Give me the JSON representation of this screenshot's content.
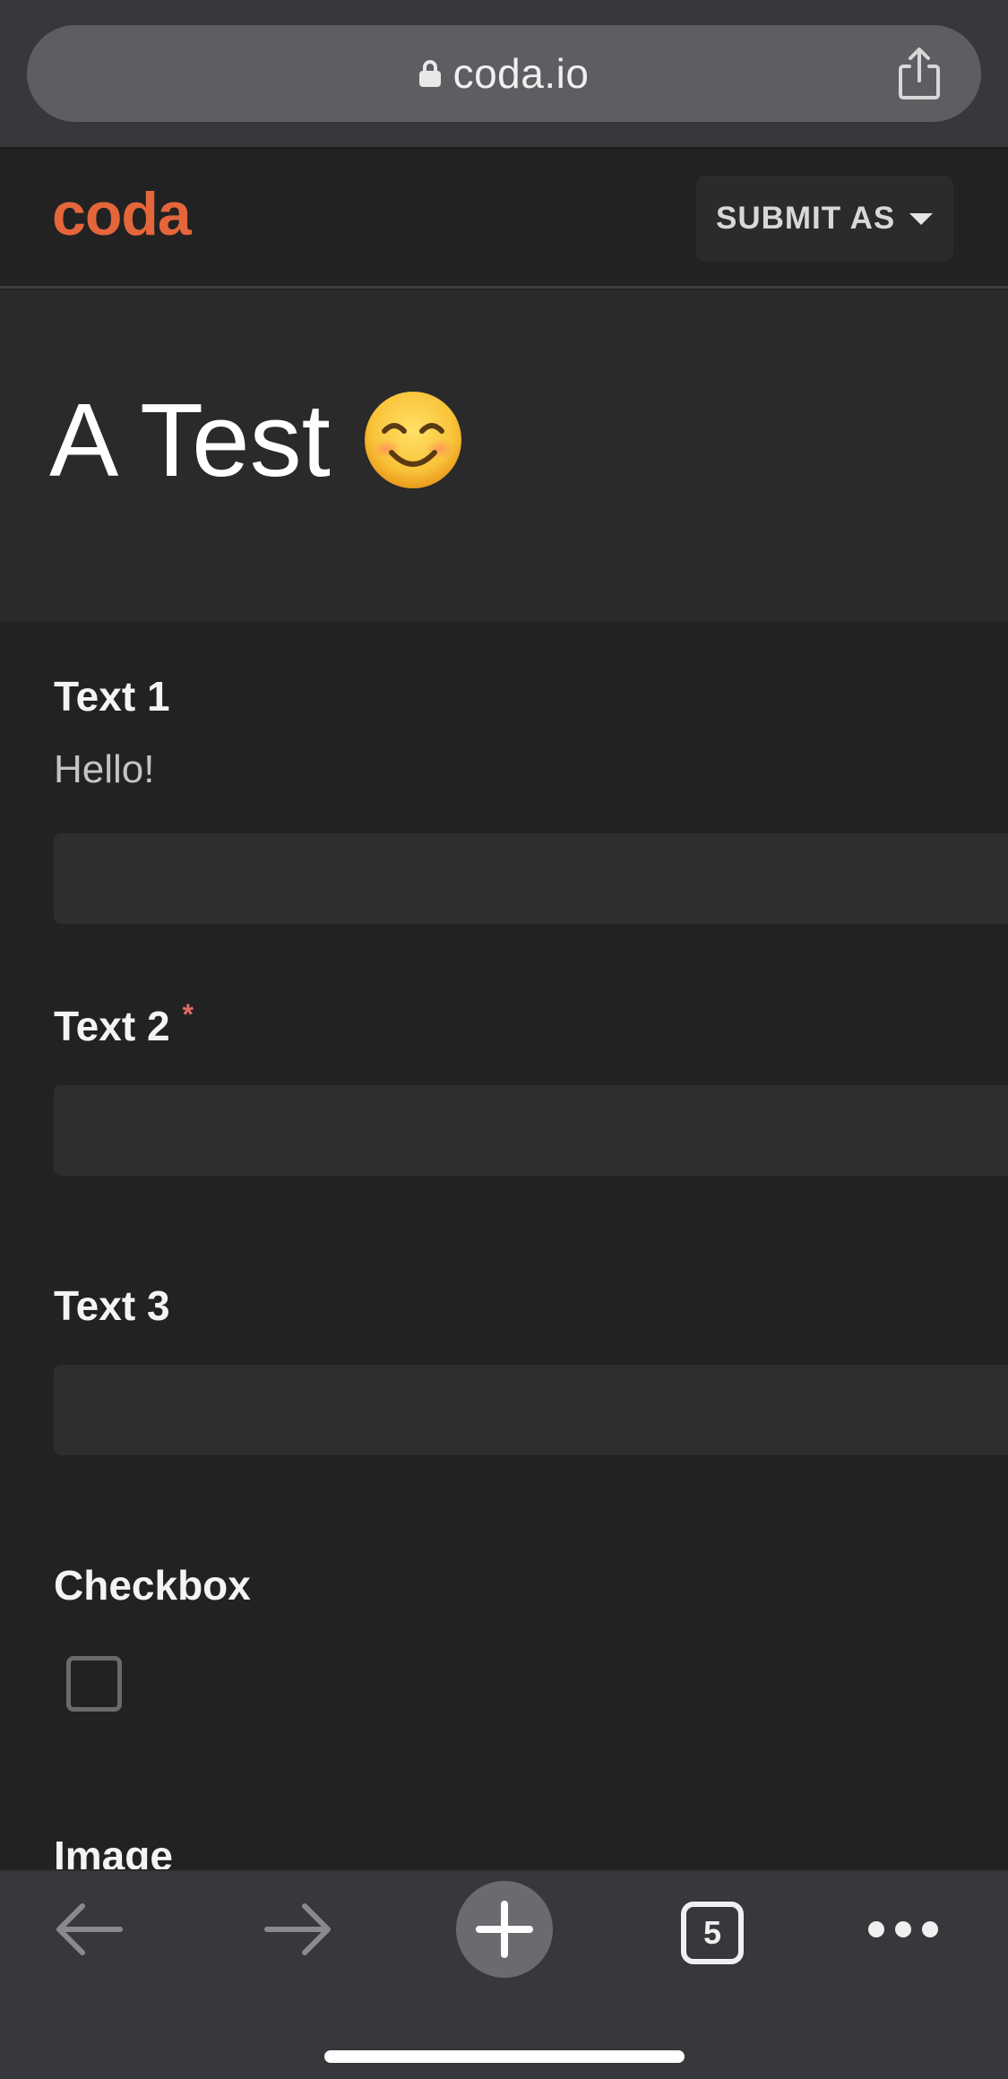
{
  "browser": {
    "url": "coda.io",
    "tabs_count": "5"
  },
  "header": {
    "logo": "coda",
    "submit_as_label": "SUBMIT AS"
  },
  "form": {
    "title": "A Test",
    "title_emoji": "smiling-face-emoji",
    "fields": [
      {
        "label": "Text 1",
        "help": "Hello!",
        "value": "",
        "required": false
      },
      {
        "label": "Text 2",
        "required_mark": "*",
        "value": "",
        "required": true
      },
      {
        "label": "Text 3",
        "value": "",
        "required": false
      },
      {
        "label": "Checkbox",
        "checked": false
      },
      {
        "label": "Image"
      }
    ]
  },
  "colors": {
    "brand": "#e5663a",
    "required": "#e06b5f",
    "background": "#222223",
    "title_band": "#2a2a2b",
    "input_bg": "#2e2e30",
    "browser_chrome": "#37383c"
  },
  "icons": {
    "back": "arrow-left-icon",
    "forward": "arrow-right-icon",
    "new_tab": "plus-icon",
    "tabs": "tabs-icon",
    "more": "more-dots-icon",
    "share": "share-icon",
    "lock": "lock-icon"
  }
}
